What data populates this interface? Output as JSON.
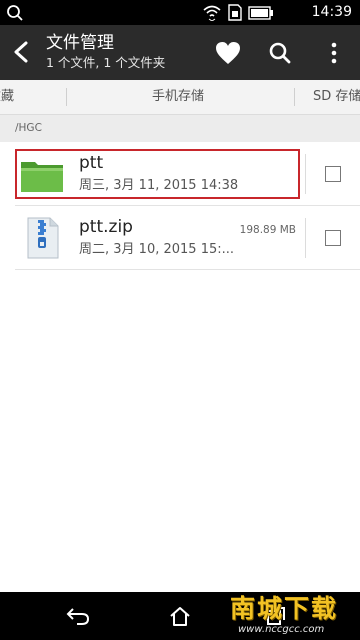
{
  "status_bar": {
    "time": "14:39",
    "icons": [
      "search-icon",
      "wifi-icon",
      "sim-icon",
      "battery-icon"
    ]
  },
  "app_bar": {
    "title": "文件管理",
    "subtitle": "1 个文件, 1 个文件夹",
    "actions": [
      "heart-icon",
      "search-icon",
      "more-vert-icon"
    ]
  },
  "tabs": {
    "left": "收藏",
    "center": "手机存储",
    "right": "SD 存储"
  },
  "path": "/HGC",
  "files": [
    {
      "name": "ptt",
      "meta": "周三, 3月 11, 2015 14:38",
      "size": "",
      "type": "folder",
      "icon": "folder-icon",
      "checked": false
    },
    {
      "name": "ptt.zip",
      "meta": "周二, 3月 10, 2015 15:...",
      "size": "198.89 MB",
      "type": "zip",
      "icon": "zip-icon",
      "checked": false
    }
  ],
  "watermark": {
    "text": "南城下载",
    "url": "www.nccgcc.com"
  },
  "colors": {
    "app_bar": "#2b2b2b",
    "folder": "#5dab3c",
    "highlight": "#c8262b",
    "watermark": "#f2c224"
  }
}
